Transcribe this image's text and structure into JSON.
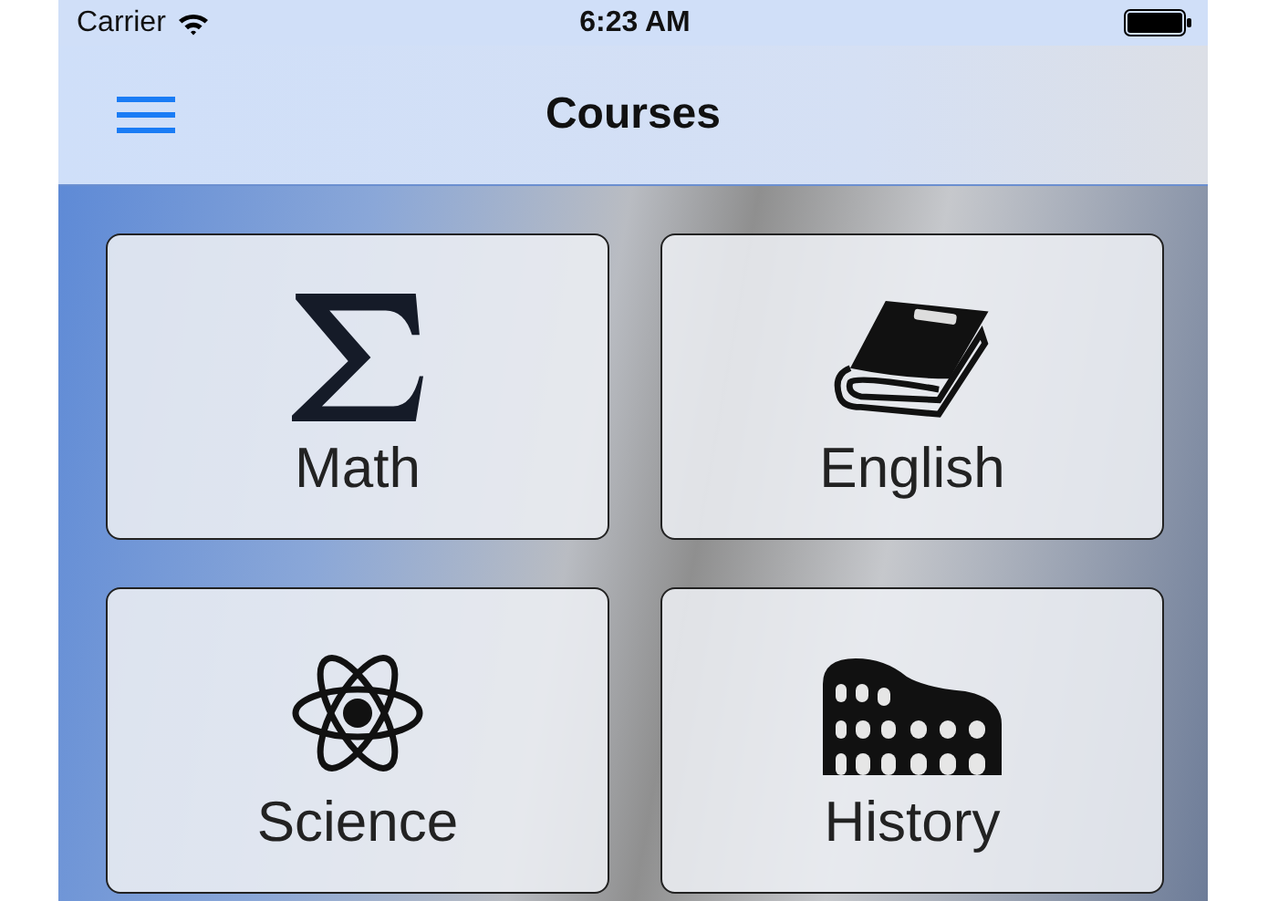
{
  "status_bar": {
    "carrier": "Carrier",
    "time": "6:23 AM"
  },
  "nav_bar": {
    "title": "Courses"
  },
  "courses": [
    {
      "label": "Math"
    },
    {
      "label": "English"
    },
    {
      "label": "Science"
    },
    {
      "label": "History"
    }
  ]
}
